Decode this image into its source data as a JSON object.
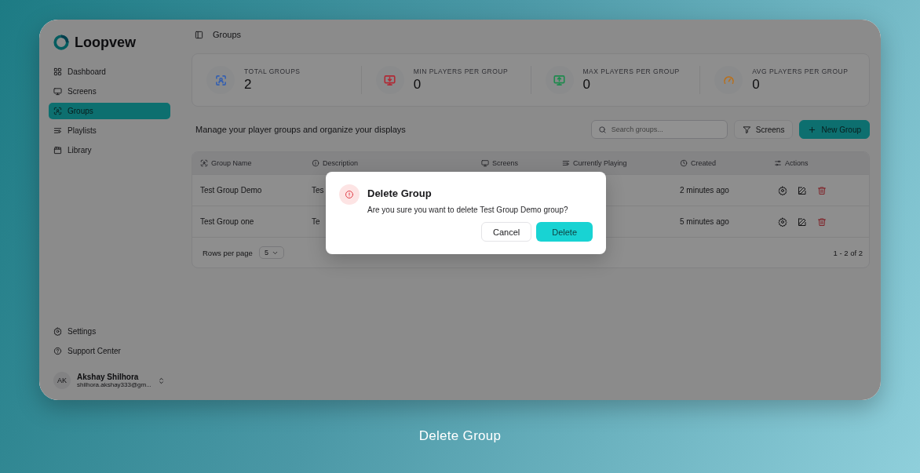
{
  "sidebar": {
    "logo": "Loopvew",
    "nav": [
      {
        "label": "Dashboard",
        "selected": false
      },
      {
        "label": "Screens",
        "selected": false
      },
      {
        "label": "Groups",
        "selected": true
      },
      {
        "label": "Playlists",
        "selected": false
      },
      {
        "label": "Library",
        "selected": false
      }
    ],
    "footer_nav": [
      {
        "label": "Settings"
      },
      {
        "label": "Support Center"
      }
    ],
    "user": {
      "initials": "AK",
      "name": "Akshay Shilhora",
      "email": "shilhora.akshay333@gm..."
    }
  },
  "header": {
    "title": "Groups"
  },
  "stats": [
    {
      "label": "TOTAL GROUPS",
      "value": "2",
      "color": "#3560b0"
    },
    {
      "label": "MIN PLAYERS PER GROUP",
      "value": "0",
      "color": "#b02a35"
    },
    {
      "label": "MAX PLAYERS PER GROUP",
      "value": "0",
      "color": "#1f8a4e"
    },
    {
      "label": "AVG PLAYERS PER GROUP",
      "value": "0",
      "color": "#b8701c"
    }
  ],
  "toolbar": {
    "description": "Manage your player groups and organize your displays",
    "search": {
      "placeholder": "Search groups..."
    },
    "filter": "Screens",
    "new_button": "New Group"
  },
  "table": {
    "columns": [
      "Group Name",
      "Description",
      "Screens",
      "Currently Playing",
      "Created",
      "Actions"
    ],
    "rows": [
      {
        "name": "Test Group Demo",
        "description": "Tes",
        "created": "2 minutes ago"
      },
      {
        "name": "Test Group one",
        "description": "Te",
        "created": "5 minutes ago"
      }
    ]
  },
  "pagination": {
    "label": "Rows per page",
    "value": "5",
    "range": "1 - 2 of 2"
  },
  "dialog": {
    "title": "Delete Group",
    "message": "Are you sure you want to delete Test Group Demo group?",
    "cancel": "Cancel",
    "confirm": "Delete"
  },
  "caption": "Delete Group"
}
